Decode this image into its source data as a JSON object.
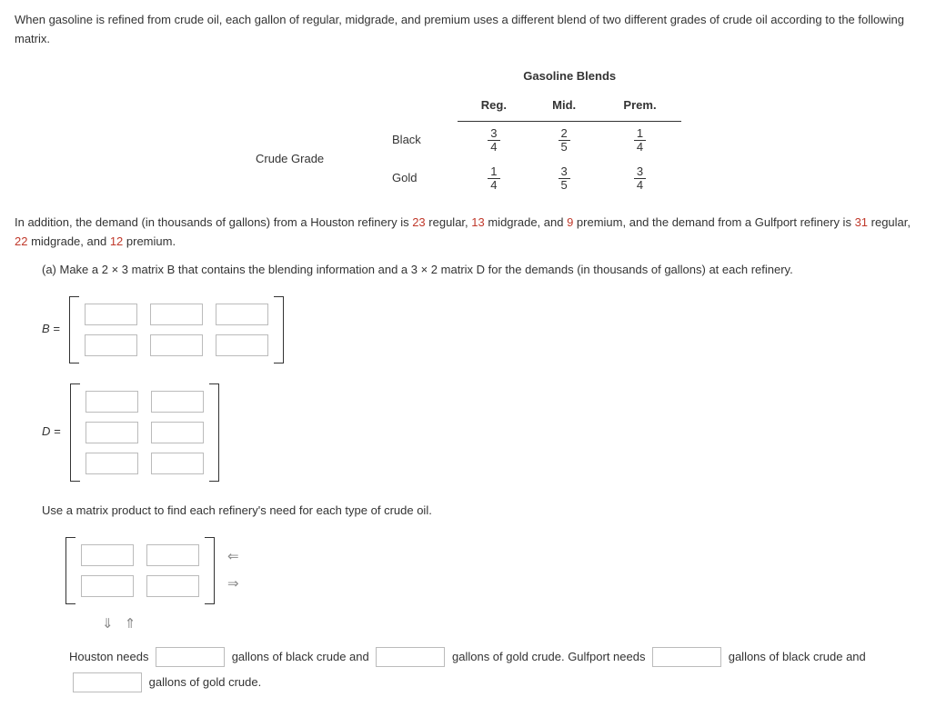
{
  "intro_pre": "When gasoline is refined from crude oil, each gallon of regular, midgrade, and premium uses a different blend of two different grades of crude oil according to the following matrix.",
  "table": {
    "group_header": "Gasoline Blends",
    "cols": {
      "c1": "Reg.",
      "c2": "Mid.",
      "c3": "Prem."
    },
    "row_group_label": "Crude Grade",
    "rows": {
      "r1": {
        "label": "Black",
        "v1n": "3",
        "v1d": "4",
        "v2n": "2",
        "v2d": "5",
        "v3n": "1",
        "v3d": "4"
      },
      "r2": {
        "label": "Gold",
        "v1n": "1",
        "v1d": "4",
        "v2n": "3",
        "v2d": "5",
        "v3n": "3",
        "v3d": "4"
      }
    }
  },
  "demand_text": {
    "p1_a": "In addition, the demand (in thousands of gallons) from a Houston refinery is ",
    "n1": "23",
    "p1_b": " regular, ",
    "n2": "13",
    "p1_c": " midgrade, and ",
    "n3": "9",
    "p1_d": " premium, and the demand from a Gulfport refinery is ",
    "n4": "31",
    "p1_e": " regular, ",
    "n5": "22",
    "p1_f": " midgrade, and ",
    "n6": "12",
    "p1_g": " premium."
  },
  "part_a": "(a) Make a 2 × 3 matrix B that contains the blending information and a 3 × 2 matrix D for the demands (in thousands of gallons) at each refinery.",
  "labels": {
    "B": "B =",
    "D": "D ="
  },
  "product_text": "Use a matrix product to find each refinery's need for each type of crude oil.",
  "fill": {
    "s1": "Houston needs",
    "s2": "gallons of black crude and",
    "s3": "gallons of gold crude. Gulfport needs",
    "s4": "gallons of black crude and",
    "s5": "gallons of gold crude."
  }
}
